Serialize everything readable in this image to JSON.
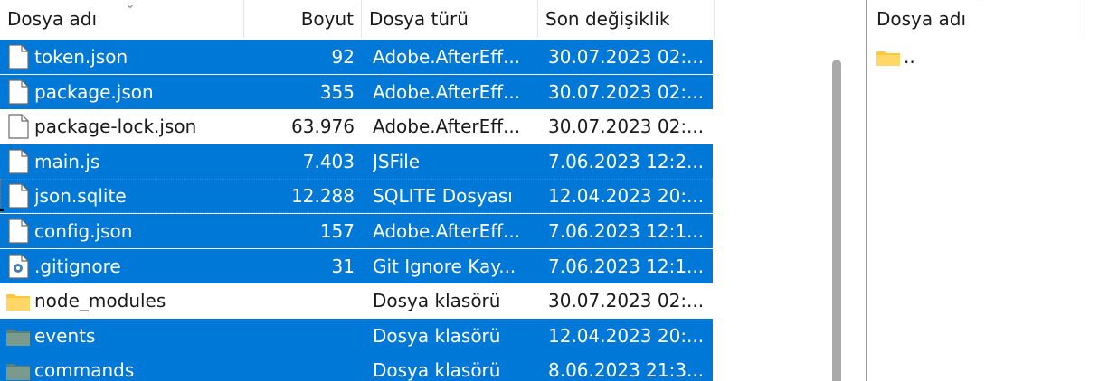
{
  "left_pane": {
    "columns": {
      "name": "Dosya adı",
      "size": "Boyut",
      "type": "Dosya türü",
      "modified": "Son değişiklik"
    },
    "rows": [
      {
        "name": "token.json",
        "size": "92",
        "type": "Adobe.AfterEff...",
        "modified": "30.07.2023 02:...",
        "icon": "file-icon",
        "selected": true
      },
      {
        "name": "package.json",
        "size": "355",
        "type": "Adobe.AfterEff...",
        "modified": "30.07.2023 02:...",
        "icon": "file-icon",
        "selected": true
      },
      {
        "name": "package-lock.json",
        "size": "63.976",
        "type": "Adobe.AfterEff...",
        "modified": "30.07.2023 02:...",
        "icon": "file-icon",
        "selected": false
      },
      {
        "name": "main.js",
        "size": "7.403",
        "type": "JSFile",
        "modified": "7.06.2023 12:2...",
        "icon": "file-icon",
        "selected": true
      },
      {
        "name": "json.sqlite",
        "size": "12.288",
        "type": "SQLITE Dosyası",
        "modified": "12.04.2023 20:...",
        "icon": "file-icon",
        "selected": true
      },
      {
        "name": "config.json",
        "size": "157",
        "type": "Adobe.AfterEff...",
        "modified": "7.06.2023 12:1...",
        "icon": "file-icon",
        "selected": true
      },
      {
        "name": ".gitignore",
        "size": "31",
        "type": "Git Ignore Kay...",
        "modified": "7.06.2023 12:1...",
        "icon": "gear-file-icon",
        "selected": true
      },
      {
        "name": "node_modules",
        "size": "",
        "type": "Dosya klasörü",
        "modified": "30.07.2023 02:...",
        "icon": "folder-icon",
        "selected": false
      },
      {
        "name": "events",
        "size": "",
        "type": "Dosya klasörü",
        "modified": "12.04.2023 20:...",
        "icon": "folder-icon",
        "selected": true
      },
      {
        "name": "commands",
        "size": "",
        "type": "Dosya klasörü",
        "modified": "8.06.2023 21:3...",
        "icon": "folder-icon",
        "selected": true
      }
    ]
  },
  "right_pane": {
    "columns": {
      "name": "Dosya adı"
    },
    "rows": [
      {
        "name": "..",
        "icon": "folder-icon"
      }
    ]
  },
  "colors": {
    "selection": "#0078d7",
    "folder": "#ffc83d",
    "folder_selected": "#5f7f74"
  }
}
